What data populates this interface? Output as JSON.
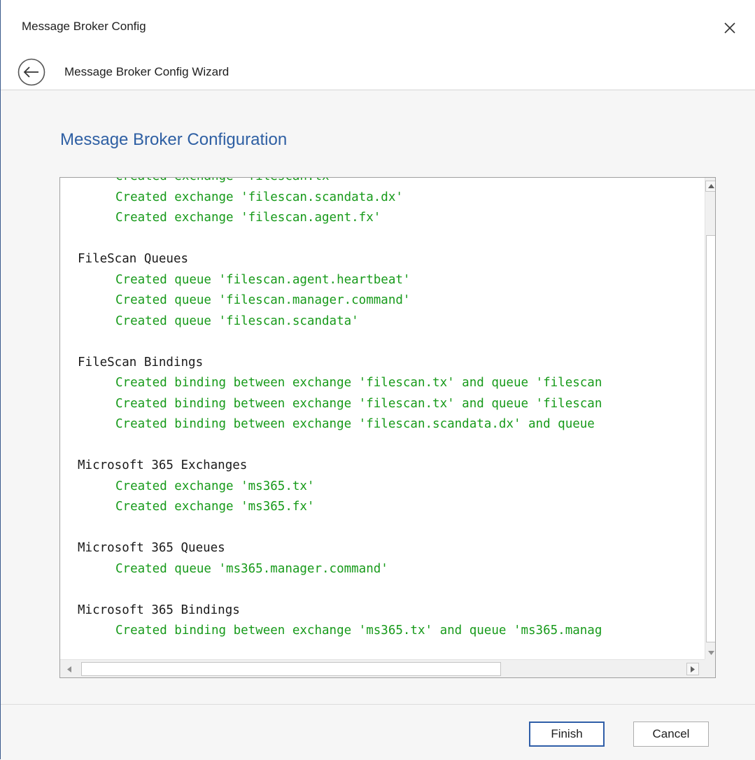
{
  "window": {
    "title": "Message Broker Config"
  },
  "wizard": {
    "title": "Message Broker Config Wizard"
  },
  "section": {
    "heading": "Message Broker Configuration"
  },
  "log": {
    "lines": [
      {
        "kind": "created",
        "text": "Created exchange 'filescan.tx'"
      },
      {
        "kind": "created",
        "text": "Created exchange 'filescan.scandata.dx'"
      },
      {
        "kind": "created",
        "text": "Created exchange 'filescan.agent.fx'"
      },
      {
        "kind": "blank",
        "text": ""
      },
      {
        "kind": "heading",
        "text": "FileScan Queues"
      },
      {
        "kind": "created",
        "text": "Created queue 'filescan.agent.heartbeat'"
      },
      {
        "kind": "created",
        "text": "Created queue 'filescan.manager.command'"
      },
      {
        "kind": "created",
        "text": "Created queue 'filescan.scandata'"
      },
      {
        "kind": "blank",
        "text": ""
      },
      {
        "kind": "heading",
        "text": "FileScan Bindings"
      },
      {
        "kind": "created",
        "text": "Created binding between exchange 'filescan.tx' and queue 'filescan"
      },
      {
        "kind": "created",
        "text": "Created binding between exchange 'filescan.tx' and queue 'filescan"
      },
      {
        "kind": "created",
        "text": "Created binding between exchange 'filescan.scandata.dx' and queue "
      },
      {
        "kind": "blank",
        "text": ""
      },
      {
        "kind": "heading",
        "text": "Microsoft 365 Exchanges"
      },
      {
        "kind": "created",
        "text": "Created exchange 'ms365.tx'"
      },
      {
        "kind": "created",
        "text": "Created exchange 'ms365.fx'"
      },
      {
        "kind": "blank",
        "text": ""
      },
      {
        "kind": "heading",
        "text": "Microsoft 365 Queues"
      },
      {
        "kind": "created",
        "text": "Created queue 'ms365.manager.command'"
      },
      {
        "kind": "blank",
        "text": ""
      },
      {
        "kind": "heading",
        "text": "Microsoft 365 Bindings"
      },
      {
        "kind": "created",
        "text": "Created binding between exchange 'ms365.tx' and queue 'ms365.manag"
      }
    ]
  },
  "buttons": {
    "finish": "Finish",
    "cancel": "Cancel"
  },
  "icons": {
    "close": "close-icon",
    "back": "back-arrow-icon",
    "scroll_up": "scroll-up-arrow-icon",
    "scroll_down": "scroll-down-arrow-icon",
    "scroll_left": "scroll-left-arrow-icon",
    "scroll_right": "scroll-right-arrow-icon"
  },
  "colors": {
    "heading_blue": "#2e5fa3",
    "log_green": "#179a1a",
    "finish_border": "#2f5ea8"
  }
}
